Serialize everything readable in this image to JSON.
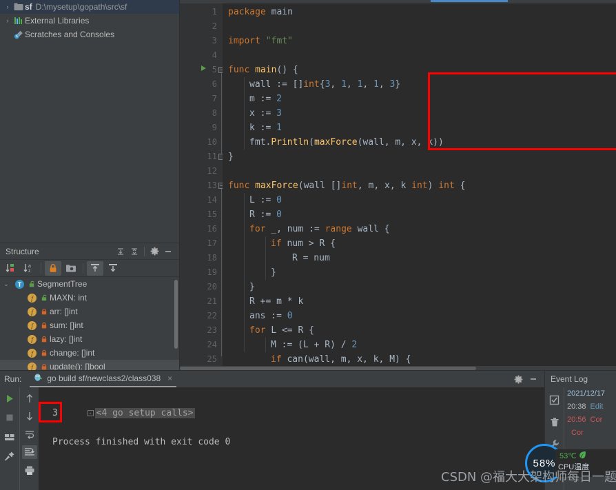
{
  "project": {
    "items": [
      {
        "arrow": "›",
        "icon": "folder-icon",
        "name": "sf",
        "path": "D:\\mysetup\\gopath\\src\\sf",
        "selected": true
      },
      {
        "arrow": "›",
        "icon": "libraries-icon",
        "name": "External Libraries",
        "path": "",
        "selected": false
      },
      {
        "arrow": "",
        "icon": "scratches-icon",
        "name": "Scratches and Consoles",
        "path": "",
        "selected": false
      }
    ]
  },
  "structure": {
    "title": "Structure",
    "header_buttons": [
      "expand-all-icon",
      "collapse-all-icon",
      "gear-icon",
      "minimize-icon"
    ],
    "toolbar_buttons": [
      "sort-by-visibility-icon",
      "sort-alphabetically-icon",
      "show-non-public-icon",
      "group-icon",
      "scroll-from-source-icon",
      "scroll-to-source-icon"
    ],
    "items": [
      {
        "indent": 0,
        "arrow": "⌄",
        "kind": "T",
        "vis": "public",
        "label": "SegmentTree",
        "highlight": false
      },
      {
        "indent": 1,
        "arrow": "",
        "kind": "f",
        "vis": "public",
        "label": "MAXN: int",
        "highlight": false
      },
      {
        "indent": 1,
        "arrow": "",
        "kind": "f",
        "vis": "private",
        "label": "arr: []int",
        "highlight": false
      },
      {
        "indent": 1,
        "arrow": "",
        "kind": "f",
        "vis": "private",
        "label": "sum: []int",
        "highlight": false
      },
      {
        "indent": 1,
        "arrow": "",
        "kind": "f",
        "vis": "private",
        "label": "lazy: []int",
        "highlight": false
      },
      {
        "indent": 1,
        "arrow": "",
        "kind": "f",
        "vis": "private",
        "label": "change: []int",
        "highlight": false
      },
      {
        "indent": 1,
        "arrow": "",
        "kind": "f",
        "vis": "private",
        "label": "update(): []bool",
        "highlight": true
      }
    ]
  },
  "editor": {
    "lines": [
      {
        "n": 1,
        "indent": 0,
        "segs": [
          {
            "t": "package ",
            "c": "kw"
          },
          {
            "t": "main",
            "c": "typ"
          }
        ]
      },
      {
        "n": 2,
        "indent": 0,
        "segs": []
      },
      {
        "n": 3,
        "indent": 0,
        "segs": [
          {
            "t": "import ",
            "c": "kw"
          },
          {
            "t": "\"fmt\"",
            "c": "str"
          }
        ]
      },
      {
        "n": 4,
        "indent": 0,
        "segs": []
      },
      {
        "n": 5,
        "indent": 0,
        "run": true,
        "fold": "minus",
        "segs": [
          {
            "t": "func ",
            "c": "kw"
          },
          {
            "t": "main",
            "c": "fn"
          },
          {
            "t": "() {",
            "c": "typ"
          }
        ]
      },
      {
        "n": 6,
        "indent": 1,
        "segs": [
          {
            "t": "wall := []",
            "c": "typ"
          },
          {
            "t": "int",
            "c": "kw"
          },
          {
            "t": "{",
            "c": "typ"
          },
          {
            "t": "3",
            "c": "num"
          },
          {
            "t": ", ",
            "c": "typ"
          },
          {
            "t": "1",
            "c": "num"
          },
          {
            "t": ", ",
            "c": "typ"
          },
          {
            "t": "1",
            "c": "num"
          },
          {
            "t": ", ",
            "c": "typ"
          },
          {
            "t": "1",
            "c": "num"
          },
          {
            "t": ", ",
            "c": "typ"
          },
          {
            "t": "3",
            "c": "num"
          },
          {
            "t": "}",
            "c": "typ"
          }
        ]
      },
      {
        "n": 7,
        "indent": 1,
        "segs": [
          {
            "t": "m := ",
            "c": "typ"
          },
          {
            "t": "2",
            "c": "num"
          }
        ]
      },
      {
        "n": 8,
        "indent": 1,
        "segs": [
          {
            "t": "x := ",
            "c": "typ"
          },
          {
            "t": "3",
            "c": "num"
          }
        ]
      },
      {
        "n": 9,
        "indent": 1,
        "segs": [
          {
            "t": "k := ",
            "c": "typ"
          },
          {
            "t": "1",
            "c": "num"
          }
        ]
      },
      {
        "n": 10,
        "indent": 1,
        "segs": [
          {
            "t": "fmt.",
            "c": "typ"
          },
          {
            "t": "Println",
            "c": "fn"
          },
          {
            "t": "(",
            "c": "typ"
          },
          {
            "t": "maxForce",
            "c": "fn"
          },
          {
            "t": "(wall, m, x, k))",
            "c": "typ"
          }
        ]
      },
      {
        "n": 11,
        "indent": 0,
        "fold": "end",
        "segs": [
          {
            "t": "}",
            "c": "typ"
          }
        ]
      },
      {
        "n": 12,
        "indent": 0,
        "segs": []
      },
      {
        "n": 13,
        "indent": 0,
        "fold": "minus",
        "segs": [
          {
            "t": "func ",
            "c": "kw"
          },
          {
            "t": "maxForce",
            "c": "fn"
          },
          {
            "t": "(wall []",
            "c": "typ"
          },
          {
            "t": "int",
            "c": "kw"
          },
          {
            "t": ", m, x, k ",
            "c": "typ"
          },
          {
            "t": "int",
            "c": "kw"
          },
          {
            "t": ") ",
            "c": "typ"
          },
          {
            "t": "int",
            "c": "kw"
          },
          {
            "t": " {",
            "c": "typ"
          }
        ]
      },
      {
        "n": 14,
        "indent": 1,
        "segs": [
          {
            "t": "L := ",
            "c": "typ"
          },
          {
            "t": "0",
            "c": "num"
          }
        ]
      },
      {
        "n": 15,
        "indent": 1,
        "segs": [
          {
            "t": "R := ",
            "c": "typ"
          },
          {
            "t": "0",
            "c": "num"
          }
        ]
      },
      {
        "n": 16,
        "indent": 1,
        "fold": "minus",
        "segs": [
          {
            "t": "for ",
            "c": "kw"
          },
          {
            "t": "_, num := ",
            "c": "typ"
          },
          {
            "t": "range ",
            "c": "kw"
          },
          {
            "t": "wall {",
            "c": "typ"
          }
        ]
      },
      {
        "n": 17,
        "indent": 2,
        "fold": "minus",
        "segs": [
          {
            "t": "if ",
            "c": "kw"
          },
          {
            "t": "num > R {",
            "c": "typ"
          }
        ]
      },
      {
        "n": 18,
        "indent": 3,
        "segs": [
          {
            "t": "R = num",
            "c": "typ"
          }
        ]
      },
      {
        "n": 19,
        "indent": 2,
        "fold": "end",
        "segs": [
          {
            "t": "}",
            "c": "typ"
          }
        ]
      },
      {
        "n": 20,
        "indent": 1,
        "fold": "end",
        "segs": [
          {
            "t": "}",
            "c": "typ"
          }
        ]
      },
      {
        "n": 21,
        "indent": 1,
        "segs": [
          {
            "t": "R += m * k",
            "c": "typ"
          }
        ]
      },
      {
        "n": 22,
        "indent": 1,
        "segs": [
          {
            "t": "ans := ",
            "c": "typ"
          },
          {
            "t": "0",
            "c": "num"
          }
        ]
      },
      {
        "n": 23,
        "indent": 1,
        "fold": "minus",
        "segs": [
          {
            "t": "for ",
            "c": "kw"
          },
          {
            "t": "L <= R {",
            "c": "typ"
          }
        ]
      },
      {
        "n": 24,
        "indent": 2,
        "segs": [
          {
            "t": "M := (L + R) / ",
            "c": "typ"
          },
          {
            "t": "2",
            "c": "num"
          }
        ]
      },
      {
        "n": 25,
        "indent": 2,
        "fold": "minus",
        "segs": [
          {
            "t": "if ",
            "c": "kw"
          },
          {
            "t": "can(wall, m, x, k, M) {",
            "c": "typ"
          }
        ]
      }
    ]
  },
  "run": {
    "label": "Run:",
    "tab_title": "go build sf/newclass2/class038",
    "tab_close": "×",
    "toolbar_left": [
      "rerun-icon",
      "stop-icon",
      "layout-icon",
      "pin-icon"
    ],
    "toolbar_left2": [
      "up-arrow-icon",
      "down-arrow-icon",
      "soft-wrap-icon",
      "scroll-to-end-icon",
      "print-icon"
    ],
    "right_buttons": [
      "gear-icon",
      "minimize-icon"
    ],
    "console": {
      "setup_line": "<4 go setup calls>",
      "output": "3",
      "finished": "Process finished with exit code 0"
    }
  },
  "eventlog": {
    "title": "Event Log",
    "toolbar": [
      "mark-read-icon",
      "trash-icon",
      "settings-wrench-icon"
    ],
    "entries": [
      {
        "date": "2021/12/17",
        "time": "",
        "link": "",
        "red": false
      },
      {
        "date": "",
        "time": "20:38",
        "link": "Edit",
        "red": false
      },
      {
        "date": "",
        "time": "20:56",
        "link": "Cor",
        "red": true
      },
      {
        "date": "",
        "time": "",
        "link": "Cor",
        "red": true
      }
    ]
  },
  "cpu_widget": {
    "percent": "58%",
    "temperature": "53℃",
    "temp_label": "CPU温度",
    "accent": "#2196f3",
    "temp_color": "#4caf50"
  },
  "watermark": {
    "text": "CSDN @福大大架构师每日一题"
  }
}
